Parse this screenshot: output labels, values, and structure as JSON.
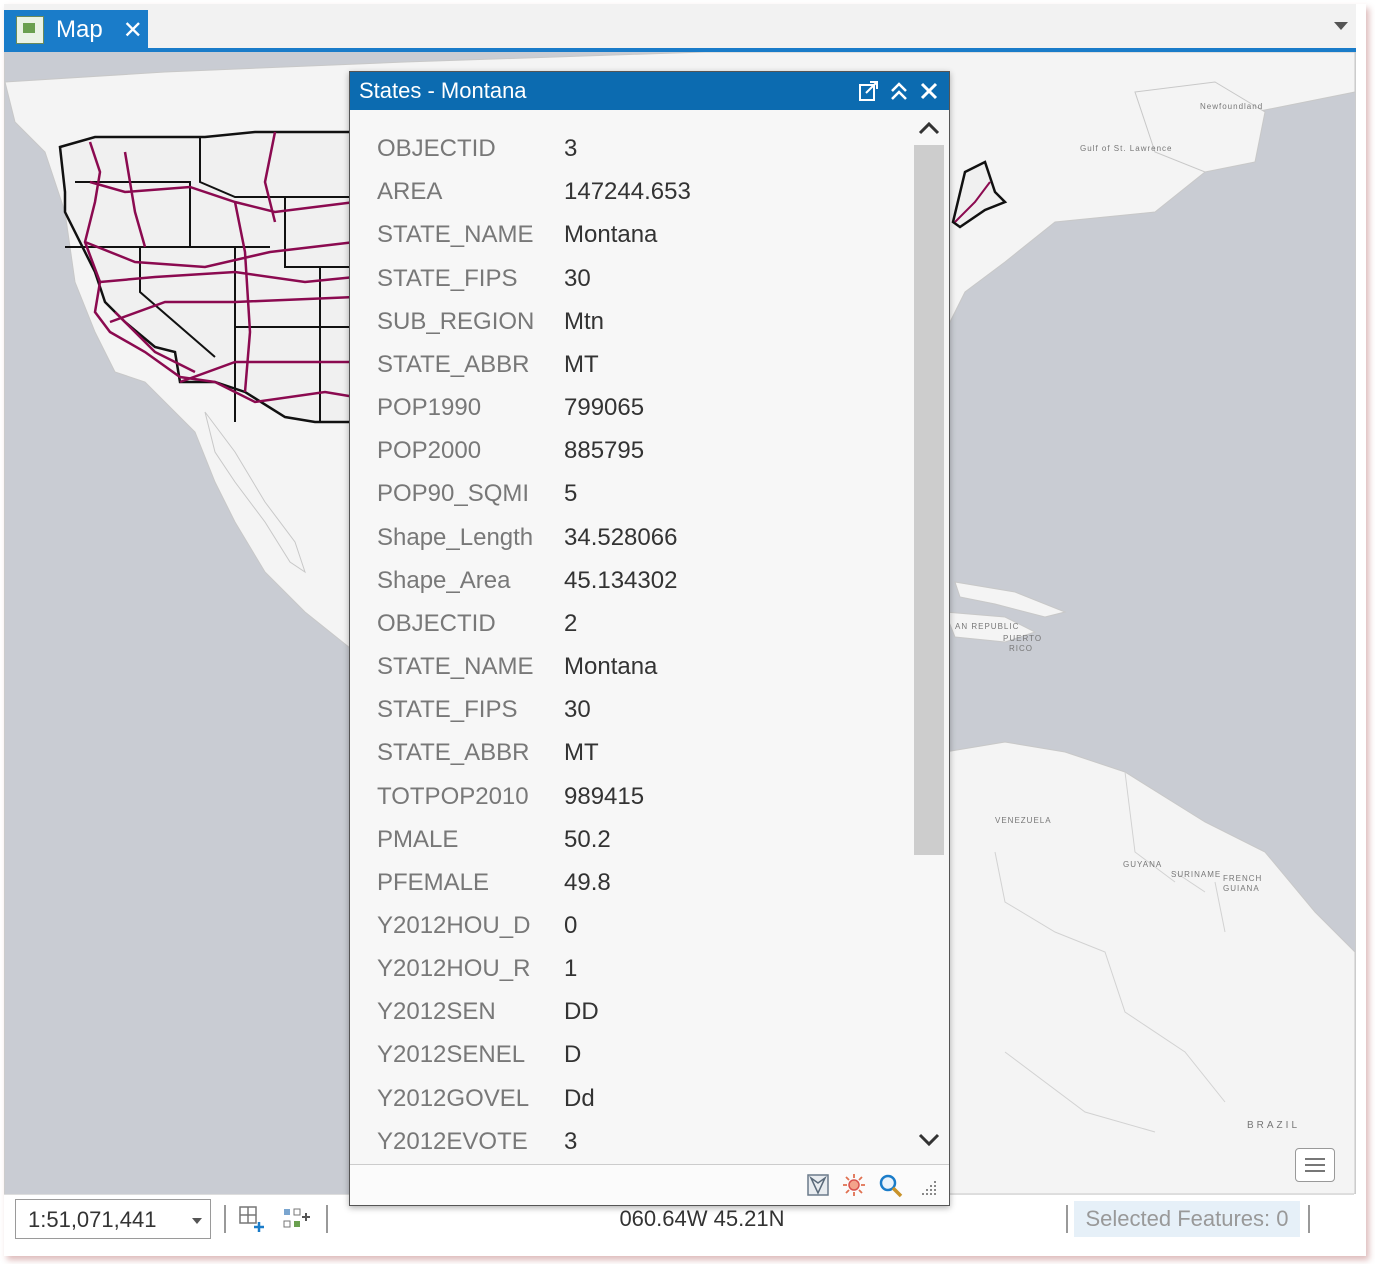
{
  "tab": {
    "title": "Map"
  },
  "map_labels": {
    "venezuela": "VENEZUELA",
    "guyana": "GUYANA",
    "suriname": "SURINAME",
    "french_guiana_1": "FRENCH",
    "french_guiana_2": "GUIANA",
    "brazil": "BRAZIL",
    "dominican_republic": "AN REPUBLIC",
    "puerto_rico_1": "PUERTO",
    "puerto_rico_2": "RICO",
    "newfoundland": "Newfoundland",
    "gulf_st_lawrence": "Gulf of St. Lawrence"
  },
  "popup": {
    "title": "States - Montana",
    "attributes": [
      {
        "field": "OBJECTID",
        "value": "3"
      },
      {
        "field": "AREA",
        "value": "147244.653"
      },
      {
        "field": "STATE_NAME",
        "value": "Montana"
      },
      {
        "field": "STATE_FIPS",
        "value": "30"
      },
      {
        "field": "SUB_REGION",
        "value": "Mtn"
      },
      {
        "field": "STATE_ABBR",
        "value": "MT"
      },
      {
        "field": "POP1990",
        "value": "799065"
      },
      {
        "field": "POP2000",
        "value": "885795"
      },
      {
        "field": "POP90_SQMI",
        "value": "5"
      },
      {
        "field": "Shape_Length",
        "value": "34.528066"
      },
      {
        "field": "Shape_Area",
        "value": "45.134302"
      },
      {
        "field": "OBJECTID",
        "value": "2"
      },
      {
        "field": "STATE_NAME",
        "value": "Montana"
      },
      {
        "field": "STATE_FIPS",
        "value": "30"
      },
      {
        "field": "STATE_ABBR",
        "value": "MT"
      },
      {
        "field": "TOTPOP2010",
        "value": "989415"
      },
      {
        "field": "PMALE",
        "value": "50.2"
      },
      {
        "field": "PFEMALE",
        "value": "49.8"
      },
      {
        "field": "Y2012HOU_D",
        "value": "0"
      },
      {
        "field": "Y2012HOU_R",
        "value": "1"
      },
      {
        "field": "Y2012SEN",
        "value": "DD"
      },
      {
        "field": "Y2012SENEL",
        "value": "D"
      },
      {
        "field": "Y2012GOVEL",
        "value": "Dd"
      },
      {
        "field": "Y2012EVOTE",
        "value": "3"
      }
    ]
  },
  "status": {
    "scale": "1:51,071,441",
    "coordinates": "060.64W 45.21N",
    "selected_features": "Selected Features: 0"
  },
  "colors": {
    "accent": "#1a7cc9",
    "popup_header": "#0c6bb0",
    "roads": "#8b0a50"
  }
}
